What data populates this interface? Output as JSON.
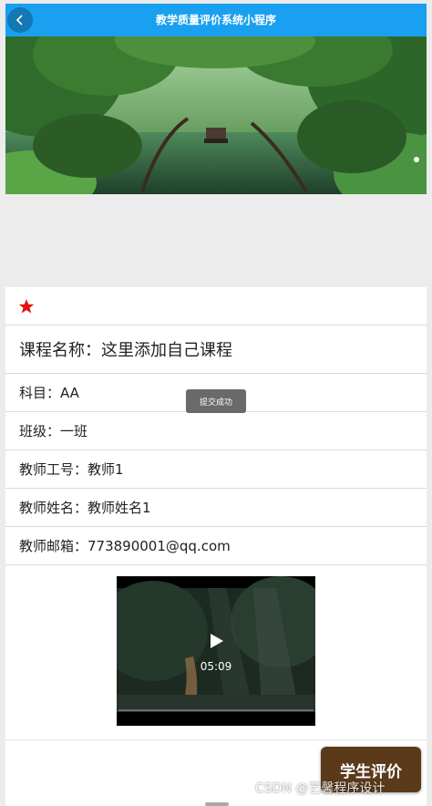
{
  "header": {
    "title": "教学质量评价系统小程序",
    "back_icon": "chevron-left-icon"
  },
  "banner": {
    "image": "river-forest-scene",
    "indicator_dots": 1
  },
  "course": {
    "favorite_icon": "star-icon",
    "favorite_color": "#e0150f",
    "name_label": "课程名称：这里添加自己课程",
    "subject": "科目：AA",
    "class": "班级：一班",
    "teacher_id": "教师工号：教师1",
    "teacher_name": "教师姓名：教师姓名1",
    "teacher_email": "教师邮箱：773890001@qq.com"
  },
  "video": {
    "duration": "05:09",
    "play_icon": "play-icon"
  },
  "toast": {
    "text": "提交成功"
  },
  "actions": {
    "evaluate_label": "学生评价"
  },
  "watermark": "CSDN @艺馨程序设计",
  "colors": {
    "header_bg": "#1aa0f0",
    "button_bg": "#5b3a1c"
  }
}
